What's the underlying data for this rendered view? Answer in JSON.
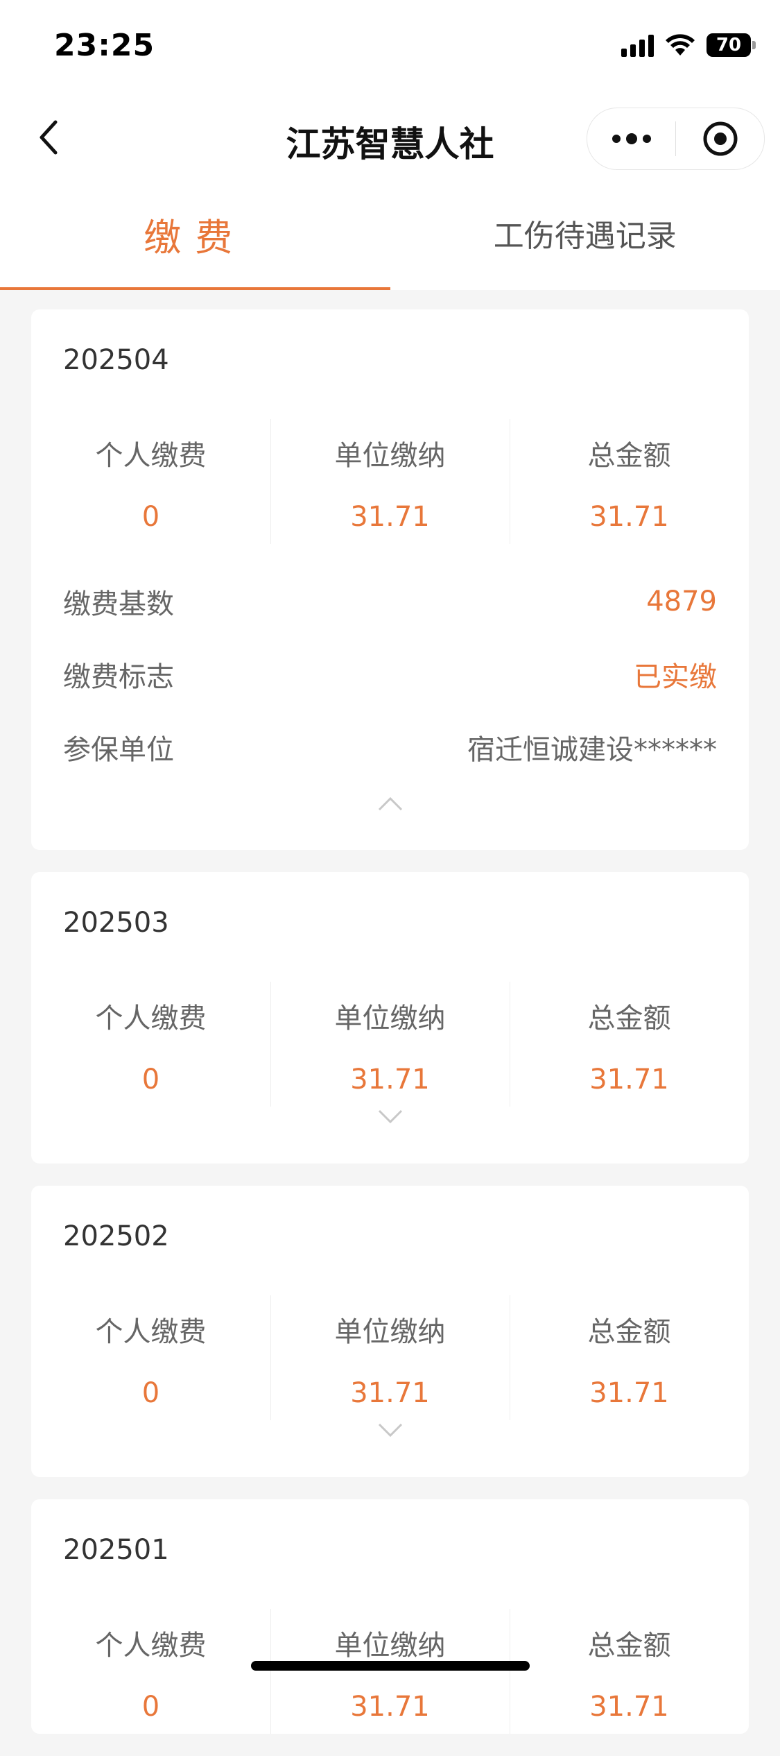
{
  "status": {
    "time": "23:25",
    "battery": "70"
  },
  "nav": {
    "title": "江苏智慧人社"
  },
  "tabs": [
    {
      "label": "缴费",
      "active": true
    },
    {
      "label": "工伤待遇记录",
      "active": false
    }
  ],
  "stat_labels": {
    "personal": "个人缴费",
    "company": "单位缴纳",
    "total": "总金额"
  },
  "records": [
    {
      "period": "202504",
      "personal": "0",
      "company": "31.71",
      "total": "31.71",
      "expanded": true,
      "details": [
        {
          "label": "缴费基数",
          "value": "4879"
        },
        {
          "label": "缴费标志",
          "value": "已实缴"
        },
        {
          "label": "参保单位",
          "value": "宿迁恒诚建设******"
        }
      ]
    },
    {
      "period": "202503",
      "personal": "0",
      "company": "31.71",
      "total": "31.71",
      "expanded": false
    },
    {
      "period": "202502",
      "personal": "0",
      "company": "31.71",
      "total": "31.71",
      "expanded": false
    },
    {
      "period": "202501",
      "personal": "0",
      "company": "31.71",
      "total": "31.71",
      "expanded": false
    }
  ],
  "colors": {
    "accent": "#e8773a",
    "background": "#f5f5f5"
  }
}
